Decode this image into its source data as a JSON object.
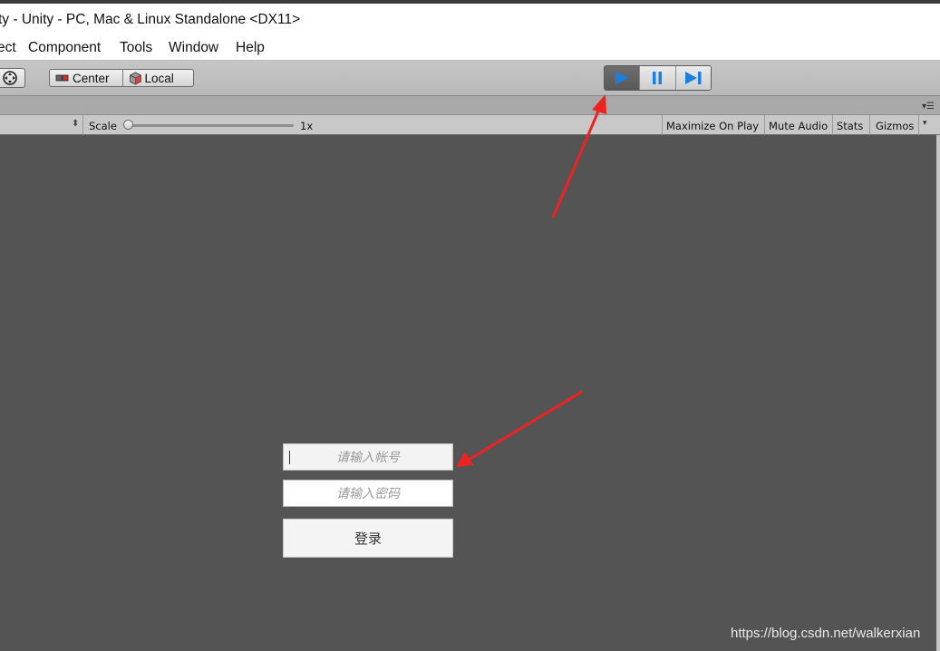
{
  "window": {
    "title": "ty - Unity - PC, Mac & Linux Standalone <DX11>"
  },
  "menu": {
    "items": [
      "ect",
      "Component",
      "Tools",
      "Window",
      "Help"
    ]
  },
  "toolbar": {
    "transform_icon": "move-tool-icon",
    "pivot": {
      "label": "Center",
      "icon": "pivot-center-icon"
    },
    "rotation": {
      "label": "Local",
      "icon": "local-cube-icon"
    },
    "playback": {
      "play_icon": "play-icon",
      "pause_icon": "pause-icon",
      "step_icon": "step-icon",
      "play_color": "#1a7fe0"
    }
  },
  "game_bar": {
    "scale_label": "Scale",
    "scale_value": "1x",
    "maximize": "Maximize On Play",
    "mute": "Mute Audio",
    "stats": "Stats",
    "gizmos": "Gizmos"
  },
  "login": {
    "account_placeholder": "请输入帐号",
    "password_placeholder": "请输入密码",
    "submit": "登录"
  },
  "watermark": "https://blog.csdn.net/walkerxian",
  "colors": {
    "annotation_arrow": "#ee2222",
    "game_background": "#545454"
  }
}
